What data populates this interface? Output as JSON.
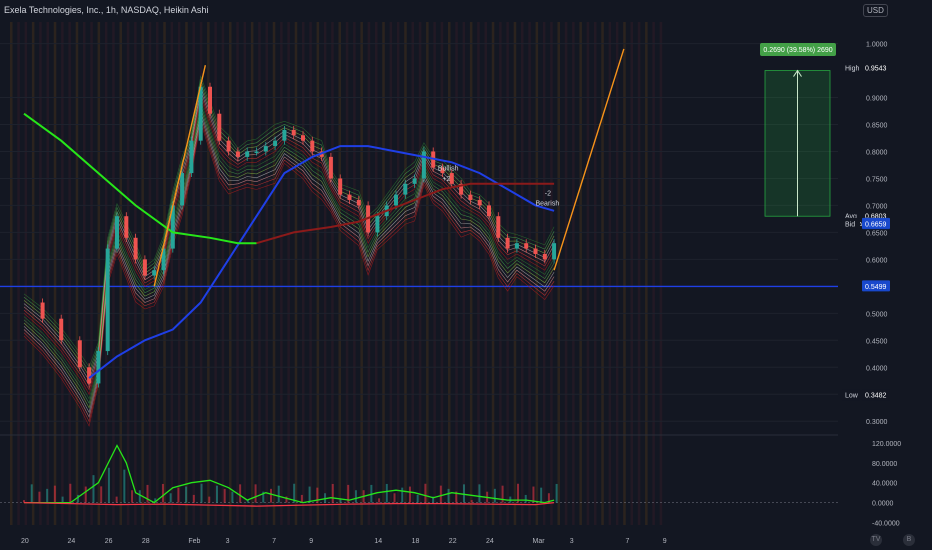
{
  "header": {
    "title": "Exela Technologies, Inc., 1h, NASDAQ, Heikin Ashi",
    "currency": "USD"
  },
  "chart_data": [
    {
      "type": "candlestick",
      "price_axis": {
        "ticks": [
          "1.0000",
          "0.9000",
          "0.8500",
          "0.8000",
          "0.7500",
          "0.7000",
          "0.6500",
          "0.6000",
          "0.5500",
          "0.5000",
          "0.4500",
          "0.4000",
          "0.3500",
          "0.3000"
        ],
        "tick_values": [
          1.0,
          0.9,
          0.85,
          0.8,
          0.75,
          0.7,
          0.65,
          0.6,
          0.55,
          0.5,
          0.45,
          0.4,
          0.35,
          0.3
        ],
        "range": [
          0.28,
          1.04
        ]
      },
      "x_axis": {
        "ticks": [
          "20",
          "24",
          "26",
          "28",
          "Feb",
          "3",
          "7",
          "9",
          "14",
          "18",
          "22",
          "24",
          "Mar",
          "3",
          "7",
          "9"
        ],
        "tick_positions": [
          0,
          5,
          9,
          13,
          18,
          22,
          27,
          31,
          38,
          42,
          46,
          50,
          55,
          59,
          65,
          69
        ]
      },
      "price_tags": [
        {
          "label": "High",
          "value": "0.9543",
          "color": "#131722",
          "text_color": "#ffffff"
        },
        {
          "label": "Avg",
          "value": "0.6803",
          "color": "#131722",
          "text_color": "#ffffff"
        },
        {
          "label": "XELA",
          "value": "0.6650",
          "color": "#0b2b82",
          "text_color": "#ffffff"
        },
        {
          "label": "Bid",
          "value": "0.6659",
          "color": "#1848cc",
          "text_color": "#ffffff"
        },
        {
          "label": "",
          "value": "0.5499",
          "color": "#1848cc",
          "text_color": "#ffffff"
        },
        {
          "label": "Low",
          "value": "0.3482",
          "color": "#131722",
          "text_color": "#ffffff"
        }
      ],
      "horizontal_line": {
        "value": 0.5499,
        "color": "#1f3fe6"
      },
      "measure": {
        "label": "0.2690 (39.58%) 2690",
        "from": 0.68,
        "to": 0.95,
        "color": "#26a641"
      },
      "annotations": [
        {
          "text": "Bullish",
          "sub": "+2"
        },
        {
          "text": "-2",
          "sub": "Bearish"
        }
      ],
      "series": [
        {
          "name": "",
          "points": [
            [
              0,
              0.52
            ],
            [
              2,
              0.49
            ],
            [
              4,
              0.45
            ],
            [
              6,
              0.4
            ],
            [
              7,
              0.37
            ],
            [
              8,
              0.43
            ],
            [
              9,
              0.62
            ],
            [
              10,
              0.68
            ],
            [
              11,
              0.64
            ],
            [
              12,
              0.6
            ],
            [
              13,
              0.57
            ],
            [
              14,
              0.58
            ],
            [
              15,
              0.62
            ],
            [
              16,
              0.7
            ],
            [
              17,
              0.76
            ],
            [
              18,
              0.82
            ],
            [
              19,
              0.92
            ],
            [
              20,
              0.87
            ],
            [
              21,
              0.82
            ],
            [
              22,
              0.8
            ],
            [
              23,
              0.79
            ],
            [
              24,
              0.8
            ],
            [
              25,
              0.8
            ],
            [
              26,
              0.81
            ],
            [
              27,
              0.82
            ],
            [
              28,
              0.84
            ],
            [
              29,
              0.83
            ],
            [
              30,
              0.82
            ],
            [
              31,
              0.8
            ],
            [
              32,
              0.79
            ],
            [
              33,
              0.75
            ],
            [
              34,
              0.72
            ],
            [
              35,
              0.71
            ],
            [
              36,
              0.7
            ],
            [
              37,
              0.65
            ],
            [
              38,
              0.68
            ],
            [
              39,
              0.7
            ],
            [
              40,
              0.72
            ],
            [
              41,
              0.74
            ],
            [
              42,
              0.75
            ],
            [
              43,
              0.8
            ],
            [
              44,
              0.77
            ],
            [
              45,
              0.76
            ],
            [
              46,
              0.74
            ],
            [
              47,
              0.72
            ],
            [
              48,
              0.71
            ],
            [
              49,
              0.7
            ],
            [
              50,
              0.68
            ],
            [
              51,
              0.64
            ],
            [
              52,
              0.62
            ],
            [
              53,
              0.63
            ],
            [
              54,
              0.62
            ],
            [
              55,
              0.61
            ],
            [
              56,
              0.6
            ],
            [
              57,
              0.63
            ]
          ]
        },
        {
          "name": "",
          "color": "#1f3fe6",
          "points": [
            [
              7,
              0.38
            ],
            [
              10,
              0.42
            ],
            [
              13,
              0.45
            ],
            [
              16,
              0.47
            ],
            [
              19,
              0.52
            ],
            [
              22,
              0.6
            ],
            [
              25,
              0.68
            ],
            [
              28,
              0.76
            ],
            [
              31,
              0.79
            ],
            [
              34,
              0.81
            ],
            [
              37,
              0.81
            ],
            [
              40,
              0.8
            ],
            [
              43,
              0.79
            ],
            [
              46,
              0.78
            ],
            [
              49,
              0.76
            ],
            [
              52,
              0.73
            ],
            [
              55,
              0.7
            ],
            [
              57,
              0.69
            ]
          ]
        },
        {
          "name": "",
          "color": "#26e619",
          "points": [
            [
              0,
              0.87
            ],
            [
              4,
              0.82
            ],
            [
              8,
              0.76
            ],
            [
              12,
              0.7
            ],
            [
              16,
              0.65
            ],
            [
              20,
              0.64
            ],
            [
              23,
              0.63
            ],
            [
              25,
              0.63
            ]
          ]
        },
        {
          "name": "",
          "color": "#8b1a1a",
          "points": [
            [
              25,
              0.63
            ],
            [
              29,
              0.65
            ],
            [
              33,
              0.66
            ],
            [
              36,
              0.67
            ],
            [
              39,
              0.69
            ],
            [
              42,
              0.71
            ],
            [
              45,
              0.73
            ],
            [
              48,
              0.74
            ],
            [
              51,
              0.74
            ],
            [
              54,
              0.74
            ],
            [
              57,
              0.74
            ]
          ]
        }
      ]
    },
    {
      "type": "area",
      "y_axis": {
        "ticks": [
          "120.0000",
          "80.0000",
          "40.0000",
          "0.0000",
          "-40.0000"
        ],
        "tick_values": [
          120,
          80,
          40,
          0,
          -40
        ],
        "range": [
          -45,
          130
        ]
      },
      "series": [
        {
          "name": "",
          "color": "#26e619",
          "points": [
            [
              0,
              0
            ],
            [
              5,
              0
            ],
            [
              8,
              40
            ],
            [
              10,
              115
            ],
            [
              11,
              80
            ],
            [
              12,
              20
            ],
            [
              14,
              0
            ],
            [
              16,
              30
            ],
            [
              18,
              40
            ],
            [
              20,
              45
            ],
            [
              22,
              30
            ],
            [
              24,
              5
            ],
            [
              26,
              20
            ],
            [
              28,
              10
            ],
            [
              30,
              0
            ],
            [
              33,
              10
            ],
            [
              35,
              5
            ],
            [
              38,
              20
            ],
            [
              40,
              25
            ],
            [
              42,
              20
            ],
            [
              44,
              10
            ],
            [
              46,
              20
            ],
            [
              48,
              15
            ],
            [
              50,
              10
            ],
            [
              52,
              5
            ],
            [
              54,
              5
            ],
            [
              56,
              0
            ],
            [
              57,
              5
            ]
          ]
        },
        {
          "name": "",
          "color": "#f23645",
          "points": [
            [
              0,
              0
            ],
            [
              5,
              -2
            ],
            [
              10,
              -4
            ],
            [
              15,
              -3
            ],
            [
              20,
              -5
            ],
            [
              25,
              -7
            ],
            [
              30,
              -5
            ],
            [
              35,
              -3
            ],
            [
              40,
              -2
            ],
            [
              45,
              -2
            ],
            [
              50,
              -3
            ],
            [
              55,
              -4
            ],
            [
              57,
              0
            ]
          ]
        }
      ]
    }
  ]
}
